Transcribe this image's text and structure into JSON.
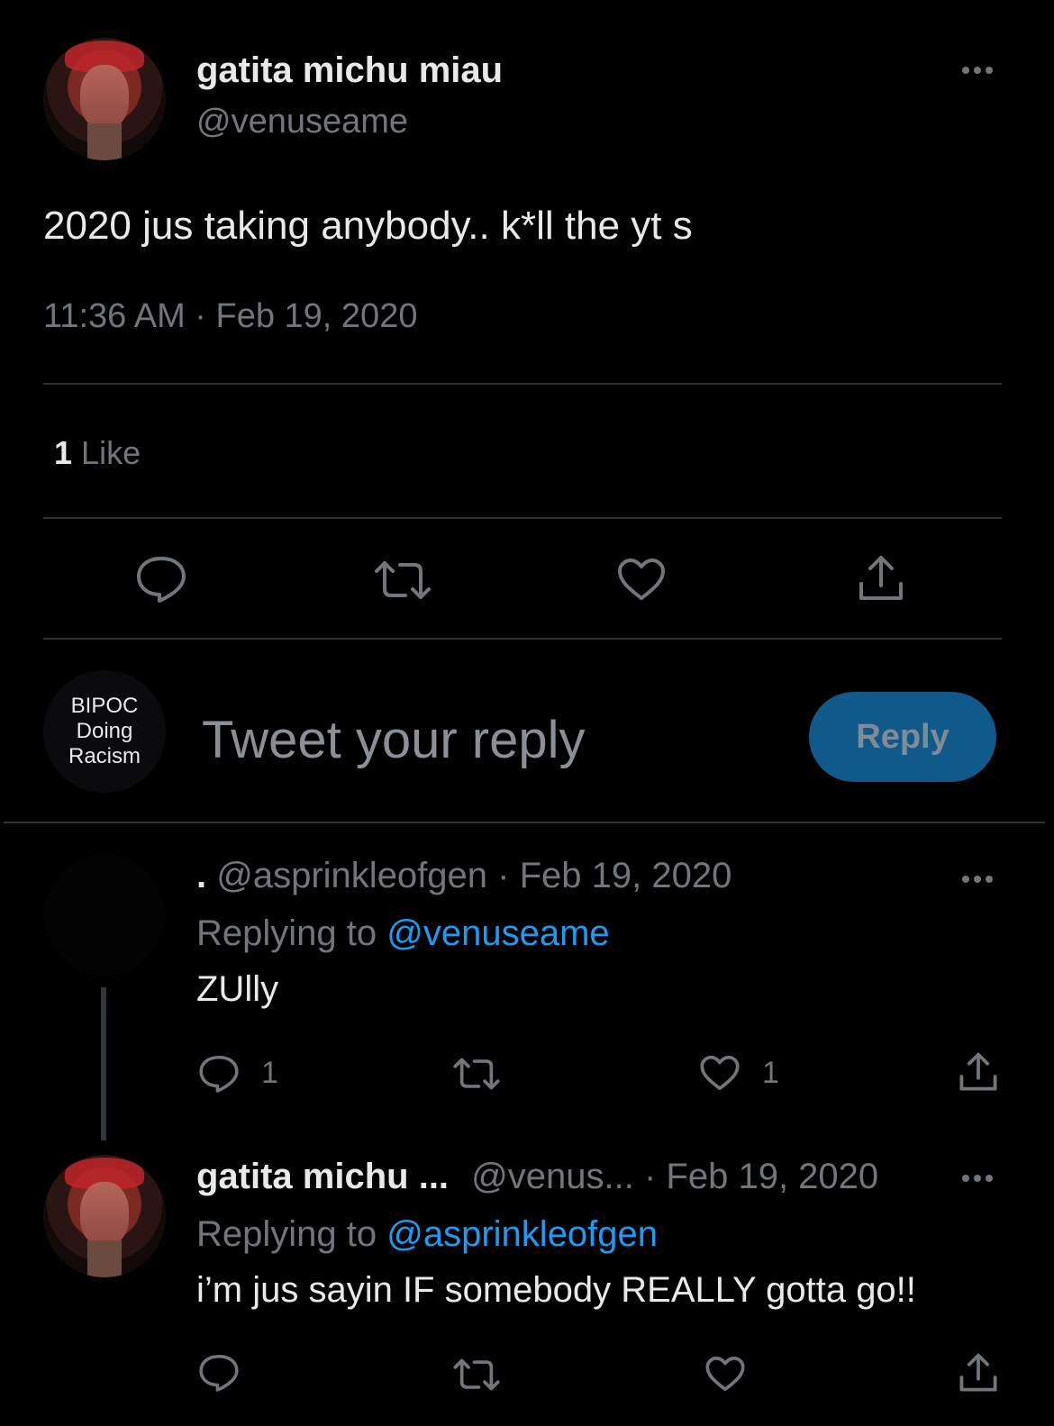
{
  "main_tweet": {
    "display_name": "gatita michu miau",
    "handle": "@venuseame",
    "text": "2020 jus taking anybody.. k*ll the yt s",
    "timestamp": "11:36 AM · Feb 19, 2020",
    "likes_count": "1",
    "likes_label": "Like"
  },
  "reply_composer": {
    "avatar_lines": [
      "BIPOC",
      "Doing",
      "Racism"
    ],
    "placeholder": "Tweet your reply",
    "button_label": "Reply"
  },
  "replies": [
    {
      "display_name": ".",
      "handle": "@asprinkleofgen",
      "date": "· Feb 19, 2020",
      "replying_to_prefix": "Replying to",
      "replying_to_handle": "@venuseame",
      "text": "ZUlly",
      "reply_count": "1",
      "retweet_count": "",
      "like_count": "1"
    },
    {
      "display_name": "gatita michu ...",
      "handle": "@venus...",
      "date": "· Feb 19, 2020",
      "replying_to_prefix": "Replying to",
      "replying_to_handle": "@asprinkleofgen",
      "text": "i’m jus sayin IF somebody REALLY gotta go!!",
      "reply_count": "",
      "retweet_count": "",
      "like_count": ""
    }
  ],
  "icons": [
    "more-icon",
    "reply-icon",
    "retweet-icon",
    "like-icon",
    "share-icon"
  ],
  "colors": {
    "background": "#000000",
    "text": "#e7e9ea",
    "muted": "#71767b",
    "link": "#1d9bf0",
    "reply_button": "#0f5a8a",
    "divider": "#2f3336"
  }
}
